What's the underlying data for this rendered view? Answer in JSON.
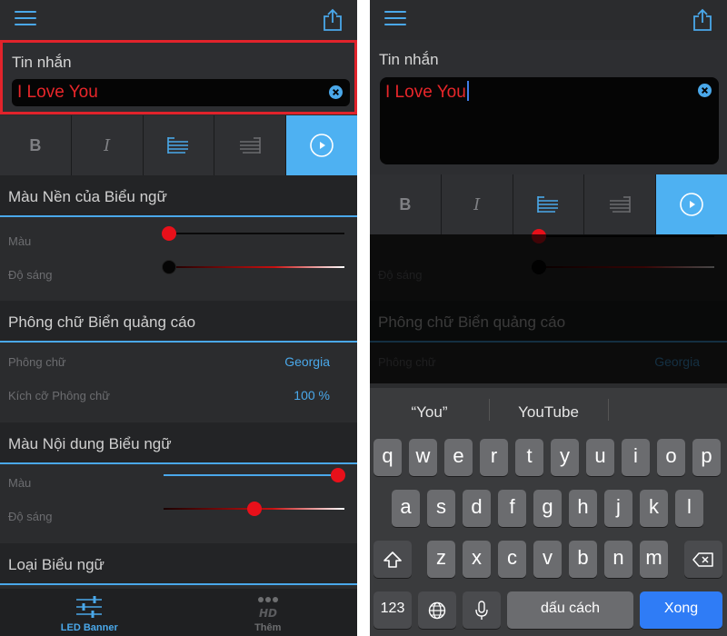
{
  "message": {
    "label": "Tin nhắn",
    "value": "I Love You"
  },
  "toolbar": {
    "bold": "B",
    "italic": "I"
  },
  "banner_background": {
    "title": "Màu Nền của Biểu ngữ",
    "color_label": "Màu",
    "color_level": 0.0,
    "brightness_label": "Độ sáng",
    "brightness_level": 0.0
  },
  "font_section": {
    "title": "Phông chữ Biển quảng cáo",
    "font_label": "Phông chữ",
    "font_value": "Georgia",
    "size_label": "Kích cỡ Phông chữ",
    "size_value": "100 %"
  },
  "content_color": {
    "title": "Màu Nội dung Biểu ngữ",
    "color_label": "Màu",
    "color_level": 1.0,
    "brightness_label": "Độ sáng",
    "brightness_level": 0.5
  },
  "banner_type": {
    "title": "Loại Biểu ngữ"
  },
  "tabs": {
    "led": "LED Banner",
    "more": "Thêm"
  },
  "keyboard": {
    "suggestions": [
      "“You”",
      "YouTube",
      ""
    ],
    "row1": [
      "q",
      "w",
      "e",
      "r",
      "t",
      "y",
      "u",
      "i",
      "o",
      "p"
    ],
    "row2": [
      "a",
      "s",
      "d",
      "f",
      "g",
      "h",
      "j",
      "k",
      "l"
    ],
    "row3": [
      "z",
      "x",
      "c",
      "v",
      "b",
      "n",
      "m"
    ],
    "numbers": "123",
    "space": "dấu cách",
    "done": "Xong"
  },
  "colors": {
    "accent": "#4aa8ea",
    "highlight": "#e1232b",
    "text_red": "#e8262a",
    "active_button": "#4eb1f2",
    "key_return": "#2f7cf6"
  }
}
